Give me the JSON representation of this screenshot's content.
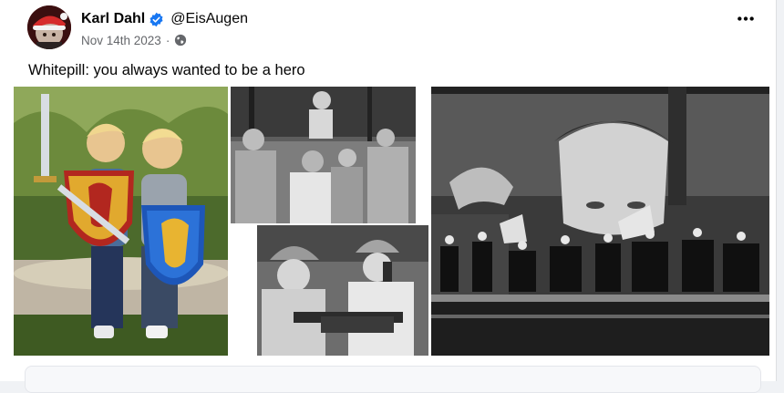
{
  "post": {
    "author_name": "Karl Dahl",
    "handle": "@EisAugen",
    "date": "Nov 14th 2023",
    "separator": "·",
    "text": "Whitepill: you always wanted to be a hero"
  },
  "icons": {
    "verified": "verified-badge-icon",
    "audience": "globe-icon",
    "more": "more-options-icon"
  },
  "colors": {
    "verified_blue": "#1877f2",
    "secondary_text": "#65676b"
  }
}
